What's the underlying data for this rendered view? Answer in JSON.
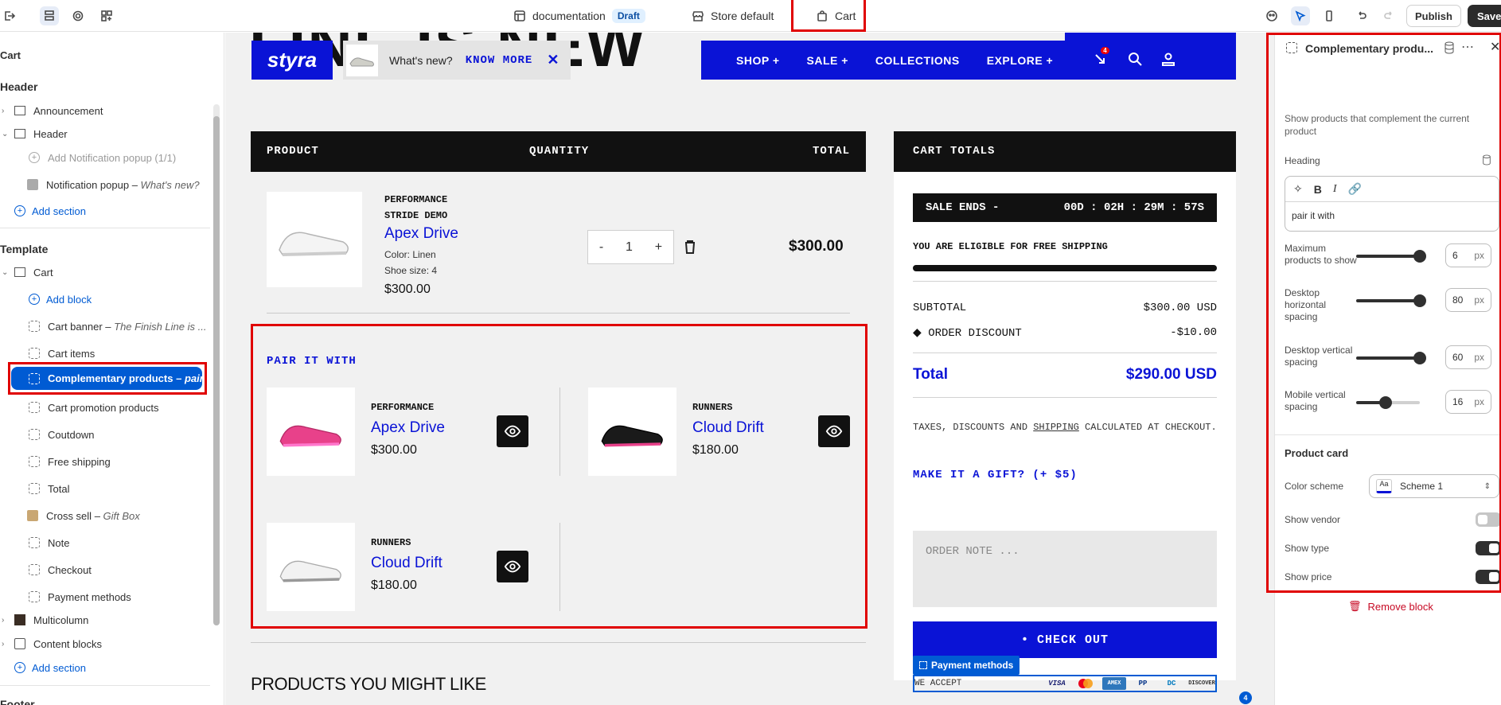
{
  "topbar": {
    "theme_name": "documentation",
    "status_badge": "Draft",
    "store": "Store default",
    "page": "Cart",
    "publish_label": "Publish",
    "save_label": "Save"
  },
  "left_panel": {
    "title": "Cart",
    "header_group": "Header",
    "items_header": [
      {
        "label": "Announcement"
      },
      {
        "label": "Header"
      },
      {
        "label": "Add Notification popup (1/1)"
      },
      {
        "label": "Notification popup",
        "note": "What's new?"
      }
    ],
    "add_section": "Add section",
    "template_group": "Template",
    "cart_section": "Cart",
    "add_block": "Add block",
    "blocks": [
      {
        "label": "Cart banner",
        "note": "The Finish Line is ..."
      },
      {
        "label": "Cart items",
        "note": ""
      },
      {
        "label": "Complementary products",
        "note": "pair..."
      },
      {
        "label": "Cart promotion products",
        "note": ""
      },
      {
        "label": "Coutdown",
        "note": ""
      },
      {
        "label": "Free shipping",
        "note": ""
      },
      {
        "label": "Total",
        "note": ""
      },
      {
        "label": "Cross sell",
        "note": "Gift Box"
      },
      {
        "label": "Note",
        "note": ""
      },
      {
        "label": "Checkout",
        "note": ""
      },
      {
        "label": "Payment methods",
        "note": ""
      }
    ],
    "multicolumn": "Multicolumn",
    "content_blocks": "Content blocks",
    "add_section_2": "Add section",
    "footer_group": "Footer"
  },
  "store": {
    "logo": "styra",
    "promo_text": "What's new?",
    "promo_link": "KNOW MORE",
    "nav": [
      "SHOP +",
      "SALE +",
      "COLLECTIONS",
      "EXPLORE +"
    ],
    "cart_count": "4",
    "table_headers": {
      "product": "PRODUCT",
      "quantity": "QUANTITY",
      "total": "TOTAL"
    },
    "line_item": {
      "vendor": "PERFORMANCE STRIDE DEMO",
      "vendor_line1": "PERFORMANCE",
      "vendor_line2": "STRIDE DEMO",
      "title": "Apex Drive",
      "color": "Color: Linen",
      "size": "Shoe size: 4",
      "price": "$300.00",
      "quantity": "1",
      "minus": "-",
      "plus": "+",
      "line_total": "$300.00"
    },
    "pair_heading": "PAIR IT WITH",
    "pair_products": [
      {
        "vendor": "PERFORMANCE",
        "title": "Apex Drive",
        "price": "$300.00"
      },
      {
        "vendor": "RUNNERS",
        "title": "Cloud Drift",
        "price": "$180.00"
      },
      {
        "vendor": "RUNNERS",
        "title": "Cloud Drift",
        "price": "$180.00"
      }
    ],
    "might_like": "PRODUCTS YOU MIGHT LIKE",
    "totals": {
      "heading": "CART TOTALS",
      "sale_label": "SALE ENDS -",
      "sale_timer": "00D : 02H : 29M : 57S",
      "free_ship": "YOU ARE ELIGIBLE FOR FREE SHIPPING",
      "free_ship_progress": 1.0,
      "subtotal_label": "SUBTOTAL",
      "subtotal_value": "$300.00 USD",
      "discount_label": "ORDER DISCOUNT",
      "discount_value": "-$10.00",
      "total_label": "Total",
      "total_value": "$290.00 USD",
      "taxes_pre": "TAXES, DISCOUNTS AND ",
      "taxes_link": "SHIPPING",
      "taxes_post": " CALCULATED AT CHECKOUT.",
      "gift": "MAKE IT A GIFT? (+ $5)",
      "note_placeholder": "ORDER NOTE ...",
      "checkout": "• CHECK OUT",
      "payment_tag": "Payment methods",
      "we_accept": "WE ACCEPT",
      "cards": [
        "VISA",
        "MC",
        "AMEX",
        "PP",
        "DC",
        "DISCOVER"
      ]
    },
    "badge_count": "4"
  },
  "right_panel": {
    "title": "Complementary produ...",
    "description": "Show products that complement the current product",
    "heading_label": "Heading",
    "heading_value": "pair it with",
    "settings": [
      {
        "label": "Maximum products to show",
        "value": "6",
        "unit": "px",
        "level": 1.0
      },
      {
        "label": "Desktop horizontal spacing",
        "value": "80",
        "unit": "px",
        "level": 1.0
      },
      {
        "label": "Desktop vertical spacing",
        "value": "60",
        "unit": "px",
        "level": 1.0
      },
      {
        "label": "Mobile vertical spacing",
        "value": "16",
        "unit": "px",
        "level": 0.45
      }
    ],
    "product_card": "Product card",
    "color_scheme_label": "Color scheme",
    "color_scheme_value": "Scheme 1",
    "show_vendor": "Show vendor",
    "show_type": "Show type",
    "show_price": "Show price",
    "remove_block": "Remove block"
  },
  "colors": {
    "accent": "#0a13d6",
    "admin_blue": "#005bd3",
    "highlight": "#e00000"
  }
}
